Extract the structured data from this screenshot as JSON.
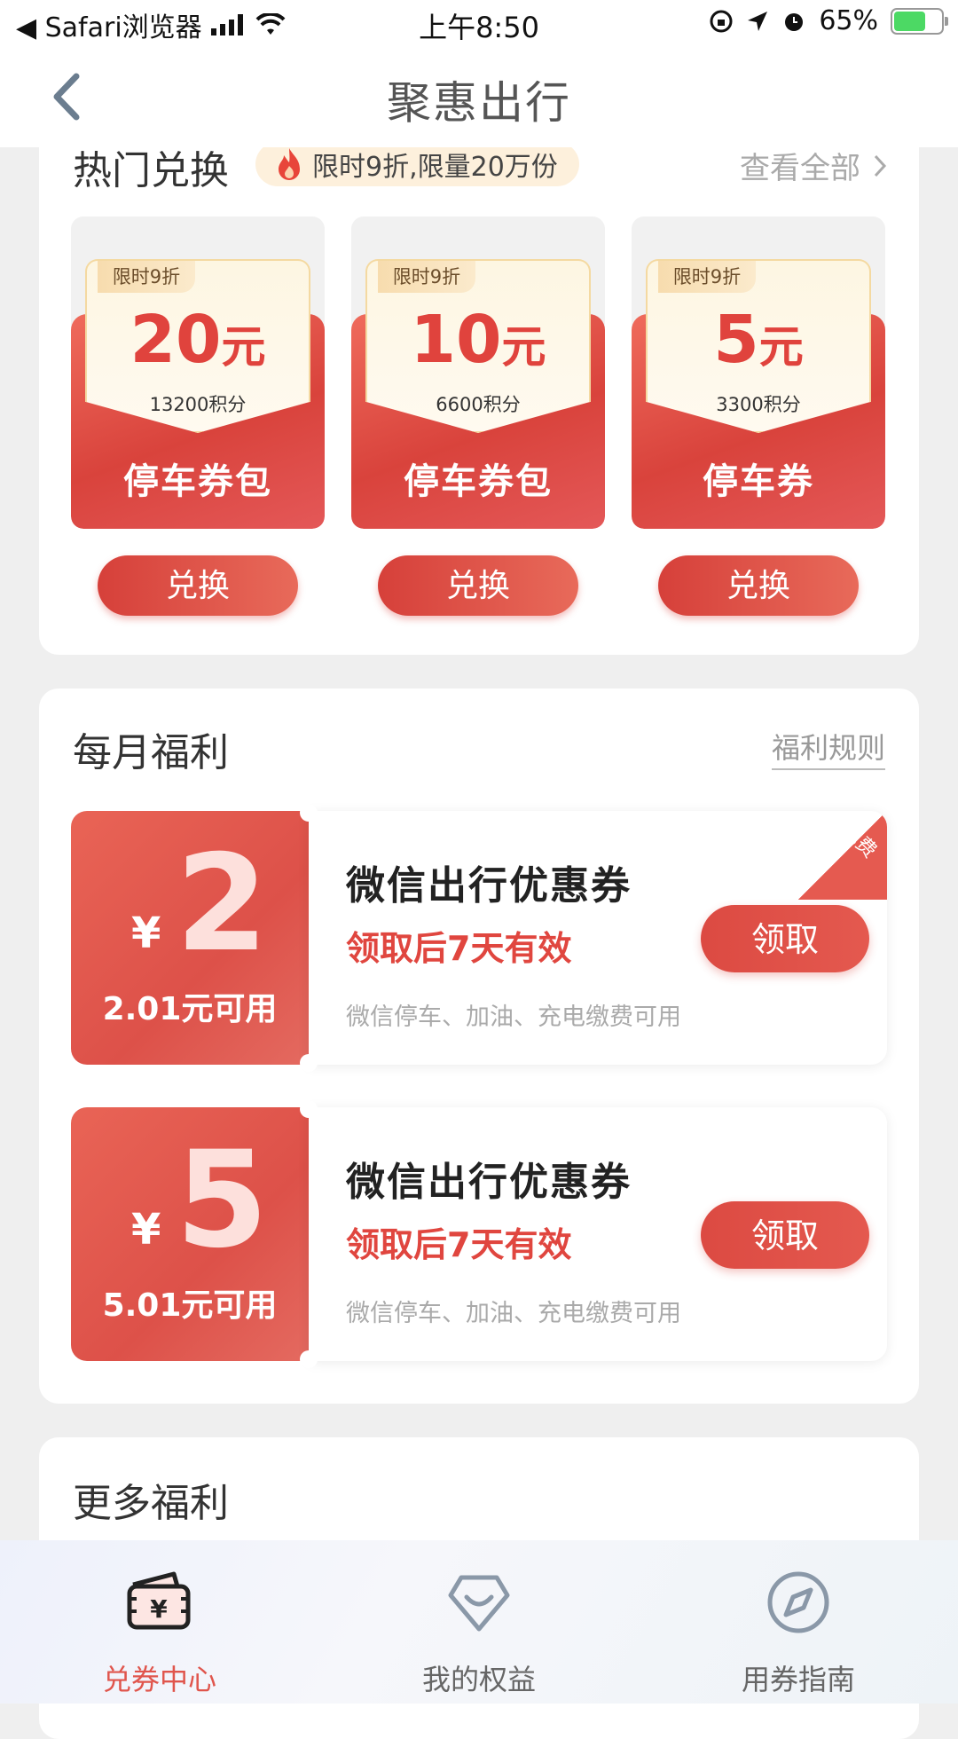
{
  "status_bar": {
    "back_app": "◀ Safari浏览器",
    "time": "上午8:50",
    "battery": "65%"
  },
  "nav": {
    "title": "聚惠出行"
  },
  "hot_exchange": {
    "title": "热门兑换",
    "promo": "限时9折,限量20万份",
    "view_all": "查看全部",
    "items": [
      {
        "tag": "限时9折",
        "amount": "20",
        "unit": "元",
        "points": "13200积分",
        "name": "停车券包",
        "button": "兑换"
      },
      {
        "tag": "限时9折",
        "amount": "10",
        "unit": "元",
        "points": "6600积分",
        "name": "停车券包",
        "button": "兑换"
      },
      {
        "tag": "限时9折",
        "amount": "5",
        "unit": "元",
        "points": "3300积分",
        "name": "停车券",
        "button": "兑换"
      }
    ]
  },
  "monthly": {
    "title": "每月福利",
    "rules": "福利规则",
    "coupons": [
      {
        "symbol": "¥",
        "amount": "2",
        "usable": "2.01元可用",
        "title": "微信出行优惠券",
        "valid": "领取后7天有效",
        "desc": "微信停车、加油、充电缴费可用",
        "button": "领取",
        "badge": "免费"
      },
      {
        "symbol": "¥",
        "amount": "5",
        "usable": "5.01元可用",
        "title": "微信出行优惠券",
        "valid": "领取后7天有效",
        "desc": "微信停车、加油、充电缴费可用",
        "button": "领取",
        "badge": ""
      }
    ]
  },
  "more": {
    "title": "更多福利"
  },
  "tabbar": {
    "tabs": [
      {
        "label": "兑券中心",
        "icon": "wallet-yen-icon",
        "active": true
      },
      {
        "label": "我的权益",
        "icon": "gift-heart-icon",
        "active": false
      },
      {
        "label": "用券指南",
        "icon": "compass-icon",
        "active": false
      }
    ],
    "active_color": "#e0554c"
  }
}
